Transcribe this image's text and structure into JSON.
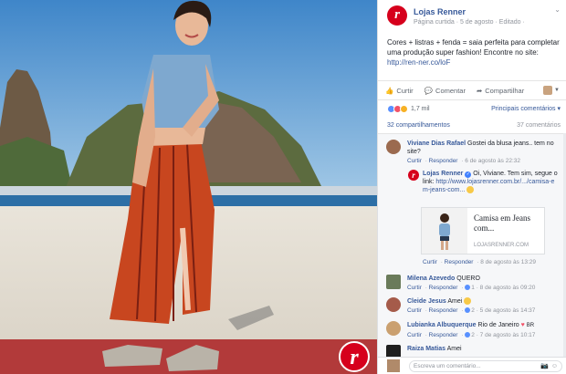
{
  "post": {
    "page_name": "Lojas Renner",
    "meta": "Página curtida · 5 de agosto · Editado ·",
    "text": "Cores + listras + fenda = saia perfeita para completar uma produção super fashion! Encontre no site:",
    "link": "http://ren-ner.co/loF"
  },
  "actions": {
    "like": "Curtir",
    "comment": "Comentar",
    "share": "Compartilhar"
  },
  "reactions": {
    "count": "1,7 mil",
    "relevant": "Principais comentários"
  },
  "counts": {
    "shares": "32 compartilhamentos",
    "comments": "37 comentários"
  },
  "comments": [
    {
      "author": "Viviane Dias Rafael",
      "text": "Gostei da blusa jeans.. tem no site?",
      "reply": "Responder",
      "like": "Curtir",
      "time": "6 de agosto às 22:32"
    },
    {
      "author": "Lojas Renner",
      "text": "Oi, Viviane. Tem sim, segue o link:",
      "link": "http://www.lojasrenner.com.br/.../camisa-em-jeans-com...",
      "like": "Curtir",
      "reply": "Responder",
      "time": "8 de agosto às 13:29",
      "preview": {
        "title": "Camisa em Jeans com...",
        "domain": "LOJASRENNER.COM"
      }
    },
    {
      "author": "Milena Azevedo",
      "text": "QUERO",
      "like": "Curtir",
      "reply": "Responder",
      "likes": "1",
      "time": "8 de agosto às 09:20"
    },
    {
      "author": "Cleide Jesus",
      "text": "Amei",
      "like": "Curtir",
      "reply": "Responder",
      "likes": "2",
      "time": "5 de agosto às 14:37"
    },
    {
      "author": "Lubianka Albuquerque",
      "text": "Rio de Janeiro",
      "suffix": "BR",
      "like": "Curtir",
      "reply": "Responder",
      "likes": "2",
      "time": "7 de agosto às 10:17"
    },
    {
      "author": "Raiza Matias",
      "text": "Amei"
    }
  ],
  "composer": {
    "placeholder": "Escreva um comentário..."
  },
  "colors": {
    "brand_red": "#d6001c",
    "link_blue": "#365899",
    "skirt": "#c8461f"
  }
}
